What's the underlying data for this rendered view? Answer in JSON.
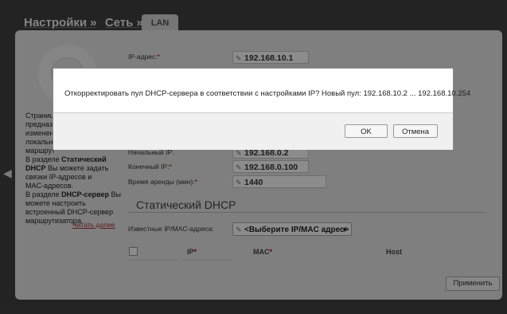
{
  "breadcrumb": {
    "settings": "Настройки »",
    "network": "Сеть »",
    "tab": "LAN"
  },
  "left_text": {
    "lines_top": [
      "Страниц",
      "предназ",
      "изменени",
      "локально",
      "маршрут"
    ],
    "line_a_prefix": "В разделе ",
    "line_a_bold": "Статический",
    "line_b_bold": "DHCP",
    "line_b_rest": " Вы можете задать",
    "line_c": "связки IP-адресов и",
    "line_d": "MAC-адресов.",
    "line_e_prefix": "В разделе ",
    "line_e_bold": "DHCP-сервер",
    "line_e_rest": " Вы",
    "line_f": "можете настроить",
    "line_g": "встроенный DHCP-сервер",
    "line_h": "маршрутизатора.",
    "read_more": "Читать далее"
  },
  "form": {
    "ip_label": "IP-адрес:",
    "ip_value": "192.168.10.1",
    "start_label_partial": "Начальный IP:",
    "start_value": "192.168.0.2",
    "end_label": "Конечный IP:",
    "end_value": "192.168.0.100",
    "lease_label": "Время аренды (мин):",
    "lease_value": "1440",
    "required_mark": "*"
  },
  "static_dhcp": {
    "title": "Статический DHCP",
    "known_label": "Известные IP/MAC-адреса:",
    "select_value": "<Выберите IP/MAC адрес>",
    "col_ip": "IP",
    "col_mac": "MAC",
    "col_host": "Host"
  },
  "apply_label": "Применить",
  "dialog": {
    "message": "Откорректировать пул DHCP-сервера в соответствии с настройками IP? Новый пул: 192.168.10.2 ... 192.168.10.254",
    "ok_label": "OK",
    "cancel_label": "Отмена"
  }
}
